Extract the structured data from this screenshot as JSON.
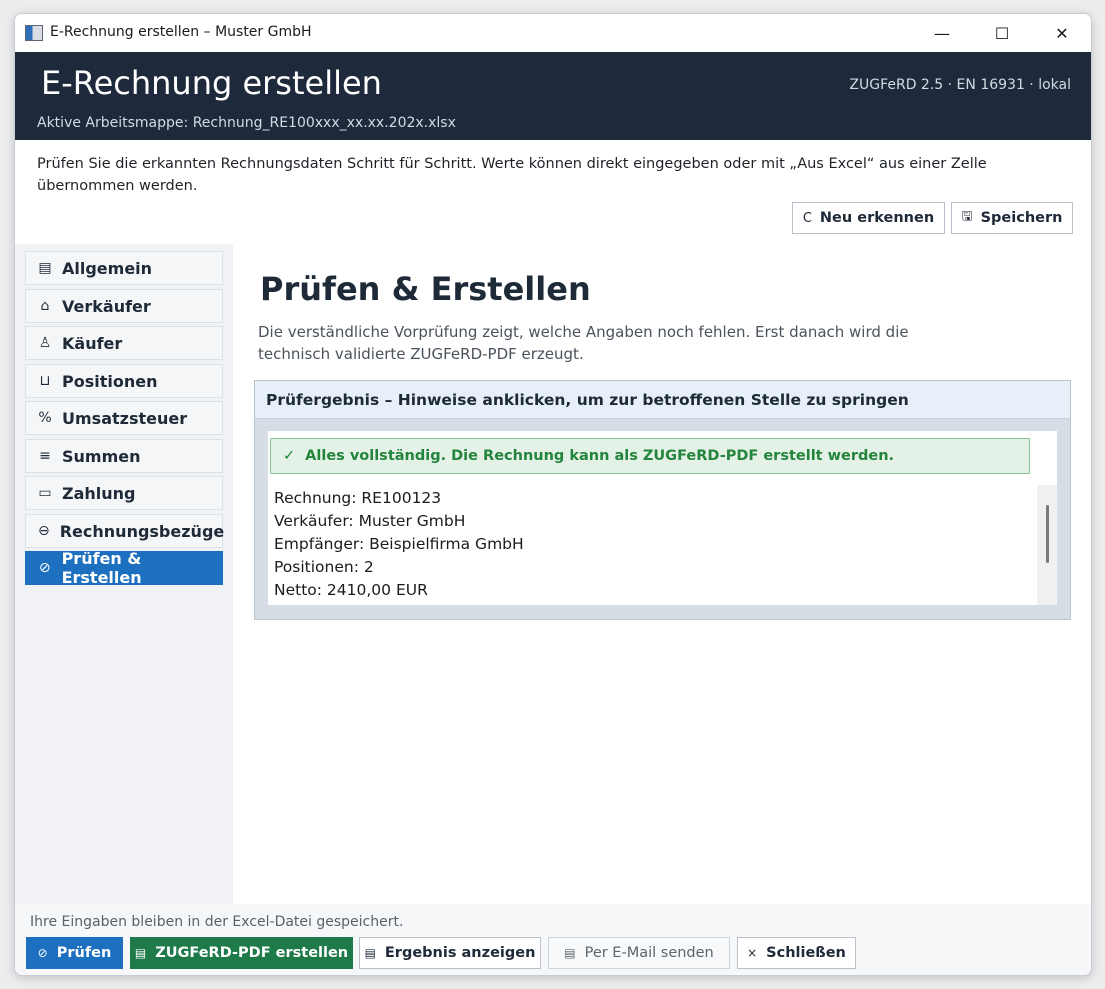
{
  "window": {
    "title": "E-Rechnung erstellen – Muster GmbH",
    "minimize_glyph": "—",
    "maximize_glyph": "☐",
    "close_glyph": "✕"
  },
  "header": {
    "title": "E-Rechnung erstellen",
    "subtitle": "Aktive Arbeitsmappe: Rechnung_RE100xxx_xx.xx.202x.xlsx",
    "standard": "ZUGFeRD 2.5 · EN 16931 · lokal"
  },
  "intro_text": "Prüfen Sie die erkannten Rechnungsdaten Schritt für Schritt. Werte können direkt eingegeben oder mit „Aus Excel“ aus einer Zelle übernommen werden.",
  "top_actions": {
    "recognize": {
      "icon": "C",
      "label": "Neu erkennen"
    },
    "save": {
      "icon": "🖫",
      "label": "Speichern"
    }
  },
  "sidebar": {
    "items": [
      {
        "icon": "▤",
        "label": "Allgemein"
      },
      {
        "icon": "⌂",
        "label": "Verkäufer"
      },
      {
        "icon": "♙",
        "label": "Käufer"
      },
      {
        "icon": "⊔",
        "label": "Positionen"
      },
      {
        "icon": "%",
        "label": "Umsatzsteuer"
      },
      {
        "icon": "≡",
        "label": "Summen"
      },
      {
        "icon": "▭",
        "label": "Zahlung"
      },
      {
        "icon": "⊖",
        "label": "Rechnungsbezüge"
      },
      {
        "icon": "⊘",
        "label": "Prüfen & Erstellen"
      }
    ],
    "active_index": 8
  },
  "main": {
    "title": "Prüfen & Erstellen",
    "description": "Die verständliche Vorprüfung zeigt, welche Angaben noch fehlen. Erst danach wird die technisch validierte ZUGFeRD-PDF erzeugt.",
    "panel": {
      "heading": "Prüfergebnis – Hinweise anklicken, um zur betroffenen Stelle zu springen",
      "success_icon": "✓",
      "success_text": "Alles vollständig. Die Rechnung kann als ZUGFeRD-PDF erstellt werden.",
      "details": [
        "Rechnung: RE100123",
        "Verkäufer: Muster GmbH",
        "Empfänger: Beispielfirma GmbH",
        "Positionen: 2",
        "Netto: 2410,00 EUR"
      ]
    }
  },
  "footer": {
    "note": "Ihre Eingaben bleiben in der Excel-Datei gespeichert.",
    "buttons": {
      "check": {
        "icon": "⊘",
        "label": "Prüfen"
      },
      "create_pdf": {
        "icon": "▤",
        "label": "ZUGFeRD-PDF erstellen"
      },
      "show_result": {
        "icon": "▤",
        "label": "Ergebnis anzeigen"
      },
      "email": {
        "icon": "▤",
        "label": "Per E-Mail senden"
      },
      "close": {
        "icon": "×",
        "label": "Schließen"
      }
    }
  },
  "colors": {
    "header_bg": "#1e2a3c",
    "accent_blue": "#1d6fbf",
    "accent_green": "#1f7a4a",
    "success_text": "#23843c",
    "success_bg": "#e3f1e6"
  }
}
